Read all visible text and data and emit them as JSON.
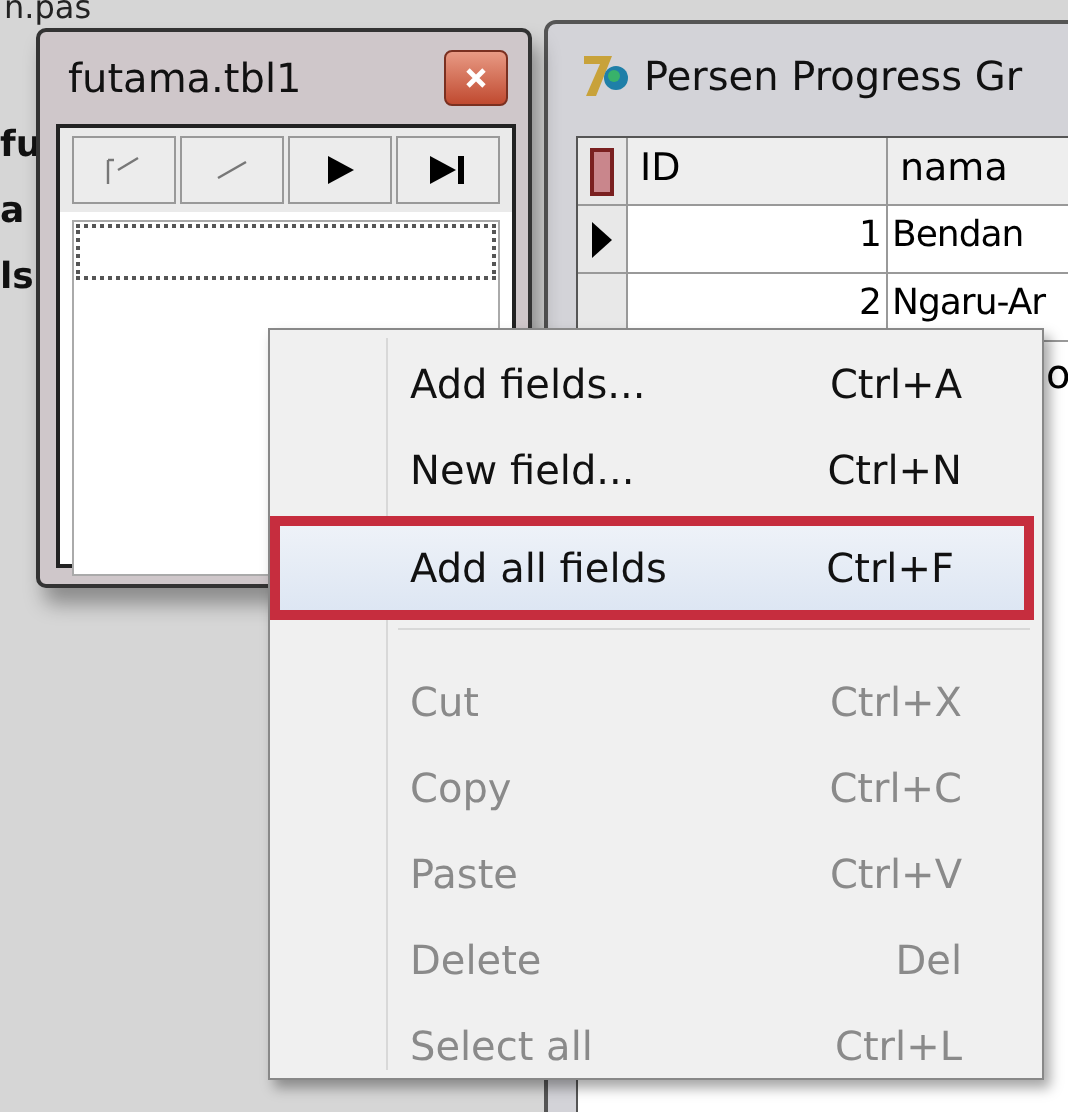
{
  "background": {
    "file_tab": "n.pas",
    "fragments": [
      "fu",
      "a",
      "ls"
    ]
  },
  "field_editor": {
    "title": "futama.tbl1",
    "navigator": [
      {
        "kind": "first"
      },
      {
        "kind": "prior"
      },
      {
        "kind": "next"
      },
      {
        "kind": "last"
      }
    ]
  },
  "grid_window": {
    "title": "Persen Progress Gr",
    "columns": [
      "ID",
      "nama"
    ],
    "rows": [
      {
        "current": true,
        "id": "1",
        "nama": "Bendan"
      },
      {
        "current": false,
        "id": "2",
        "nama": "Ngaru-Ar"
      }
    ],
    "fragment": "o"
  },
  "context_menu": {
    "items": [
      {
        "kind": "item",
        "label": "Add fields...",
        "shortcut": "Ctrl+A",
        "disabled": false,
        "selected": false
      },
      {
        "kind": "item",
        "label": "New field...",
        "shortcut": "Ctrl+N",
        "disabled": false,
        "selected": false
      },
      {
        "kind": "item",
        "label": "Add all fields",
        "shortcut": "Ctrl+F",
        "disabled": false,
        "selected": true
      },
      {
        "kind": "separator"
      },
      {
        "kind": "item",
        "label": "Cut",
        "shortcut": "Ctrl+X",
        "disabled": true,
        "selected": false
      },
      {
        "kind": "item",
        "label": "Copy",
        "shortcut": "Ctrl+C",
        "disabled": true,
        "selected": false
      },
      {
        "kind": "item",
        "label": "Paste",
        "shortcut": "Ctrl+V",
        "disabled": true,
        "selected": false
      },
      {
        "kind": "item",
        "label": "Delete",
        "shortcut": "Del",
        "disabled": true,
        "selected": false
      },
      {
        "kind": "item",
        "label": "Select all",
        "shortcut": "Ctrl+L",
        "disabled": true,
        "selected": false
      }
    ]
  }
}
